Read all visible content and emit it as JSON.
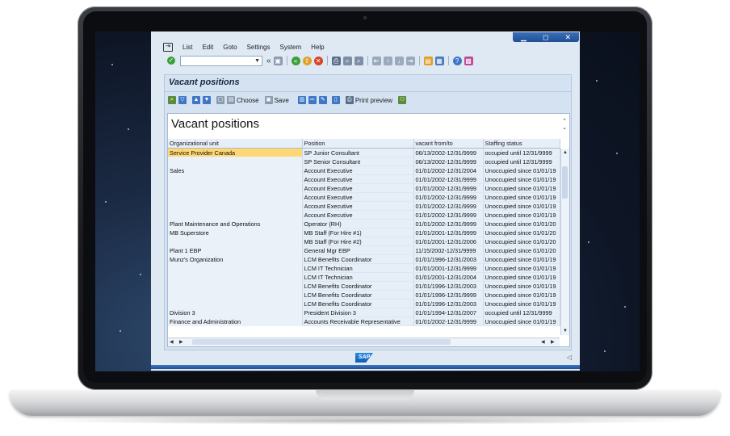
{
  "window": {
    "controls": [
      "▁",
      "◻",
      "✕"
    ]
  },
  "menu": {
    "items": [
      {
        "label": "List"
      },
      {
        "label": "Edit"
      },
      {
        "label": "Goto"
      },
      {
        "label": "Settings"
      },
      {
        "label": "System"
      },
      {
        "label": "Help"
      }
    ]
  },
  "toolbar": {
    "command_value": "",
    "back_glyph": "«"
  },
  "panel": {
    "title": "Vacant positions"
  },
  "app_toolbar": {
    "choose_label": "Choose",
    "save_label": "Save",
    "print_preview_label": "Print preview"
  },
  "report": {
    "title": "Vacant positions",
    "columns": [
      "Organizational unit",
      "Position",
      "vacant from/to",
      "Staffing status"
    ],
    "rows": [
      {
        "org": "Service Provider Canada",
        "position": "SP Junior Consultant",
        "period": "06/13/2002-12/31/9999",
        "status": "occupied until 12/31/9999"
      },
      {
        "org": "",
        "position": "SP Senior Consultant",
        "period": "06/13/2002-12/31/9999",
        "status": "occupied until 12/31/9999"
      },
      {
        "org": "Sales",
        "position": "Account Executive",
        "period": "01/01/2002-12/31/2004",
        "status": "Unoccupied since 01/01/19"
      },
      {
        "org": "",
        "position": "Account Executive",
        "period": "01/01/2002-12/31/9999",
        "status": "Unoccupied since 01/01/19"
      },
      {
        "org": "",
        "position": "Account Executive",
        "period": "01/01/2002-12/31/9999",
        "status": "Unoccupied since 01/01/19"
      },
      {
        "org": "",
        "position": "Account Executive",
        "period": "01/01/2002-12/31/9999",
        "status": "Unoccupied since 01/01/19"
      },
      {
        "org": "",
        "position": "Account Executive",
        "period": "01/01/2002-12/31/9999",
        "status": "Unoccupied since 01/01/19"
      },
      {
        "org": "",
        "position": "Account Executive",
        "period": "01/01/2002-12/31/9999",
        "status": "Unoccupied since 01/01/19"
      },
      {
        "org": "Plant Maintenance and Operations",
        "position": "Operator (RH)",
        "period": "01/01/2002-12/31/9999",
        "status": "Unoccupied since 01/01/20"
      },
      {
        "org": "MB Superstore",
        "position": "MB Staff (For Hire #1)",
        "period": "01/01/2001-12/31/9999",
        "status": "Unoccupied since 01/01/20"
      },
      {
        "org": "",
        "position": "MB Staff (For Hire #2)",
        "period": "01/01/2001-12/31/2006",
        "status": "Unoccupied since 01/01/20"
      },
      {
        "org": "Plant 1 EBP",
        "position": "General Mgr EBP",
        "period": "11/15/2002-12/31/9999",
        "status": "Unoccupied since 01/01/20"
      },
      {
        "org": "Munz's Organization",
        "position": "LCM Benefits Coordinator",
        "period": "01/01/1996-12/31/2003",
        "status": "Unoccupied since 01/01/19"
      },
      {
        "org": "",
        "position": "LCM IT Technician",
        "period": "01/01/2001-12/31/9999",
        "status": "Unoccupied since 01/01/19"
      },
      {
        "org": "",
        "position": "LCM IT Technician",
        "period": "01/01/2001-12/31/2004",
        "status": "Unoccupied since 01/01/19"
      },
      {
        "org": "",
        "position": "LCM Benefits Coordinator",
        "period": "01/01/1996-12/31/2003",
        "status": "Unoccupied since 01/01/19"
      },
      {
        "org": "",
        "position": "LCM Benefits Coordinator",
        "period": "01/01/1996-12/31/9999",
        "status": "Unoccupied since 01/01/19"
      },
      {
        "org": "",
        "position": "LCM Benefits Coordinator",
        "period": "01/01/1996-12/31/2003",
        "status": "Unoccupied since 01/01/19"
      },
      {
        "org": "Division 3",
        "position": "President Division 3",
        "period": "01/01/1994-12/31/2007",
        "status": "occupied until 12/31/9999"
      },
      {
        "org": "Finance and Administration",
        "position": "Accounts Receivable Representative",
        "period": "01/01/2002-12/31/9999",
        "status": "Unoccupied since 01/01/19"
      }
    ]
  },
  "footer": {
    "logo_text": "SAP"
  },
  "colors": {
    "highlight": "#ffd874",
    "window_bg": "#dfe9f4",
    "panel_bg": "#d4e2f1",
    "accent_blue": "#1f4f96"
  }
}
